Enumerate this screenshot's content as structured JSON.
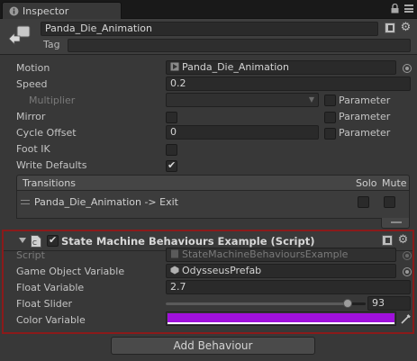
{
  "window": {
    "tab_title": "Inspector"
  },
  "header": {
    "name": "Panda_Die_Animation",
    "tag_label": "Tag",
    "tag_value": ""
  },
  "properties": {
    "motion": {
      "label": "Motion",
      "value": "Panda_Die_Animation"
    },
    "speed": {
      "label": "Speed",
      "value": "0.2"
    },
    "multiplier": {
      "label": "Multiplier",
      "param_label": "Parameter"
    },
    "mirror": {
      "label": "Mirror",
      "param_label": "Parameter",
      "checked": false
    },
    "cycle_offset": {
      "label": "Cycle Offset",
      "value": "0",
      "param_label": "Parameter"
    },
    "foot_ik": {
      "label": "Foot IK",
      "checked": false
    },
    "write_defaults": {
      "label": "Write Defaults",
      "checked": true
    }
  },
  "transitions": {
    "header": "Transitions",
    "solo_label": "Solo",
    "mute_label": "Mute",
    "items": [
      {
        "text": "Panda_Die_Animation -> Exit",
        "solo": false,
        "mute": false
      }
    ]
  },
  "component": {
    "title": "State Machine Behaviours Example (Script)",
    "enabled": true,
    "script": {
      "label": "Script",
      "value": "StateMachineBehavioursExample"
    },
    "game_object_variable": {
      "label": "Game Object Variable",
      "value": "OdysseusPrefab"
    },
    "float_variable": {
      "label": "Float Variable",
      "value": "2.7"
    },
    "float_slider": {
      "label": "Float Slider",
      "value": "93",
      "fraction": 0.93
    },
    "color_variable": {
      "label": "Color Variable",
      "color": "#a010dc"
    }
  },
  "add_behaviour_label": "Add Behaviour",
  "colors": {
    "highlight_border": "#8b1a1a",
    "panel_bg": "#383838",
    "swatch": "#a010dc"
  }
}
